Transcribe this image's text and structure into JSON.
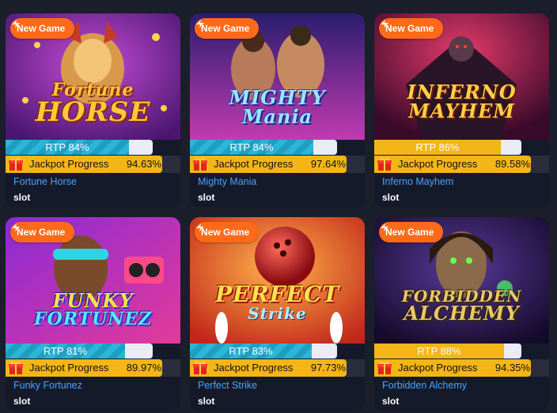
{
  "badge_label": "New Game",
  "jackpot_label": "Jackpot Progress",
  "colors": {
    "badge": "#ff6a1a",
    "rtp_fill": "#2bb5d8",
    "jackpot": "#f3b616",
    "title": "#4da1ff"
  },
  "games": [
    {
      "title": "Fortune Horse",
      "type": "slot",
      "rtp": 84,
      "rtp_label": "RTP 84%",
      "jackpot": "94.63%",
      "logo_line1": "Fortune",
      "logo_line2": "HORSE"
    },
    {
      "title": "Mighty Mania",
      "type": "slot",
      "rtp": 84,
      "rtp_label": "RTP 84%",
      "jackpot": "97.64%",
      "logo_line1": "MIGHTY",
      "logo_line2": "Mania"
    },
    {
      "title": "Inferno Mayhem",
      "type": "slot",
      "rtp": 86,
      "rtp_label": "RTP 86%",
      "jackpot": "89.58%",
      "logo_line1": "INFERNO",
      "logo_line2": "MAYHEM"
    },
    {
      "title": "Funky Fortunez",
      "type": "slot",
      "rtp": 81,
      "rtp_label": "RTP 81%",
      "jackpot": "89.97%",
      "logo_line1": "FUNKY",
      "logo_line2": "FORTUNEZ"
    },
    {
      "title": "Perfect Strike",
      "type": "slot",
      "rtp": 83,
      "rtp_label": "RTP 83%",
      "jackpot": "97.73%",
      "logo_line1": "PERFECT",
      "logo_line2": "Strike"
    },
    {
      "title": "Forbidden Alchemy",
      "type": "slot",
      "rtp": 88,
      "rtp_label": "RTP 88%",
      "jackpot": "94.35%",
      "logo_line1": "FORBIDDEN",
      "logo_line2": "ALCHEMY"
    }
  ]
}
